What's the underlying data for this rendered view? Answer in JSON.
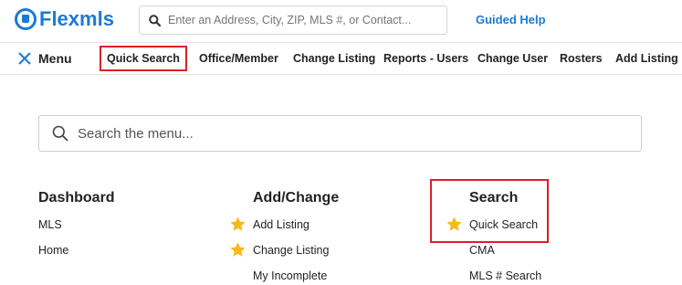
{
  "header": {
    "logo_text": "Flexmls",
    "search_placeholder": "Enter an Address, City, ZIP, MLS #, or Contact...",
    "guided_help": "Guided Help",
    "brand_color": "#1a7bd4"
  },
  "nav": {
    "menu_label": "Menu",
    "items": [
      {
        "label": "Quick Search",
        "highlighted": true
      },
      {
        "label": "Office/Member"
      },
      {
        "label": "Change Listing"
      },
      {
        "label": "Reports - Users"
      },
      {
        "label": "Change User"
      },
      {
        "label": "Rosters"
      },
      {
        "label": "Add Listing"
      }
    ]
  },
  "menu_search": {
    "placeholder": "Search the menu..."
  },
  "columns": [
    {
      "title": "Dashboard",
      "links": [
        {
          "label": "MLS",
          "favorite": false
        },
        {
          "label": "Home",
          "favorite": false
        }
      ]
    },
    {
      "title": "Add/Change",
      "links": [
        {
          "label": "Add Listing",
          "favorite": true
        },
        {
          "label": "Change Listing",
          "favorite": true
        },
        {
          "label": "My Incomplete",
          "favorite": false
        }
      ]
    },
    {
      "title": "Search",
      "links": [
        {
          "label": "Quick Search",
          "favorite": true
        },
        {
          "label": "CMA",
          "favorite": false
        },
        {
          "label": "MLS # Search",
          "favorite": false
        }
      ]
    }
  ],
  "colors": {
    "highlight_outline": "#d92128",
    "star": "#f7b91b"
  }
}
